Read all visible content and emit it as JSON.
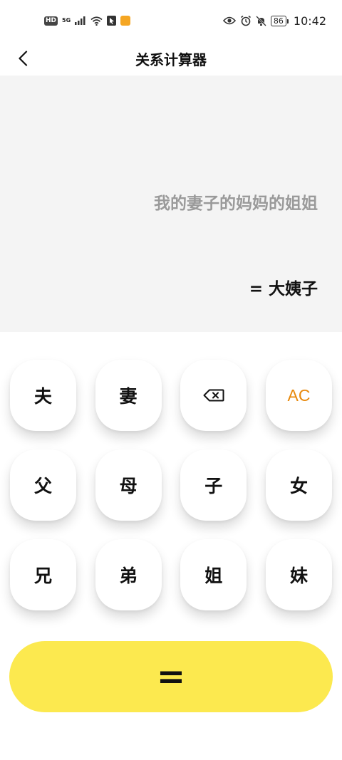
{
  "status_bar": {
    "hd_badge": "HD",
    "network": "5G",
    "battery": "86",
    "time": "10:42",
    "icons": [
      "signal-icon",
      "wifi-icon",
      "app-icon",
      "eye-icon",
      "alarm-icon",
      "mute-icon"
    ]
  },
  "header": {
    "title": "关系计算器",
    "back_icon": "chevron-left-icon"
  },
  "display": {
    "expression": "我的妻子的妈妈的姐姐",
    "result": "= 大姨子"
  },
  "keypad": {
    "rows": [
      [
        {
          "label": "夫"
        },
        {
          "label": "妻"
        },
        {
          "label": "",
          "icon": "backspace-icon"
        },
        {
          "label": "AC"
        }
      ],
      [
        {
          "label": "父"
        },
        {
          "label": "母"
        },
        {
          "label": "子"
        },
        {
          "label": "女"
        }
      ],
      [
        {
          "label": "兄"
        },
        {
          "label": "弟"
        },
        {
          "label": "姐"
        },
        {
          "label": "妹"
        }
      ]
    ],
    "equals_label": "=",
    "ac_color": "#e8890c"
  },
  "colors": {
    "accent_yellow": "#fce94f",
    "display_bg": "#f4f4f4",
    "expression_gray": "#9a9a9a"
  }
}
